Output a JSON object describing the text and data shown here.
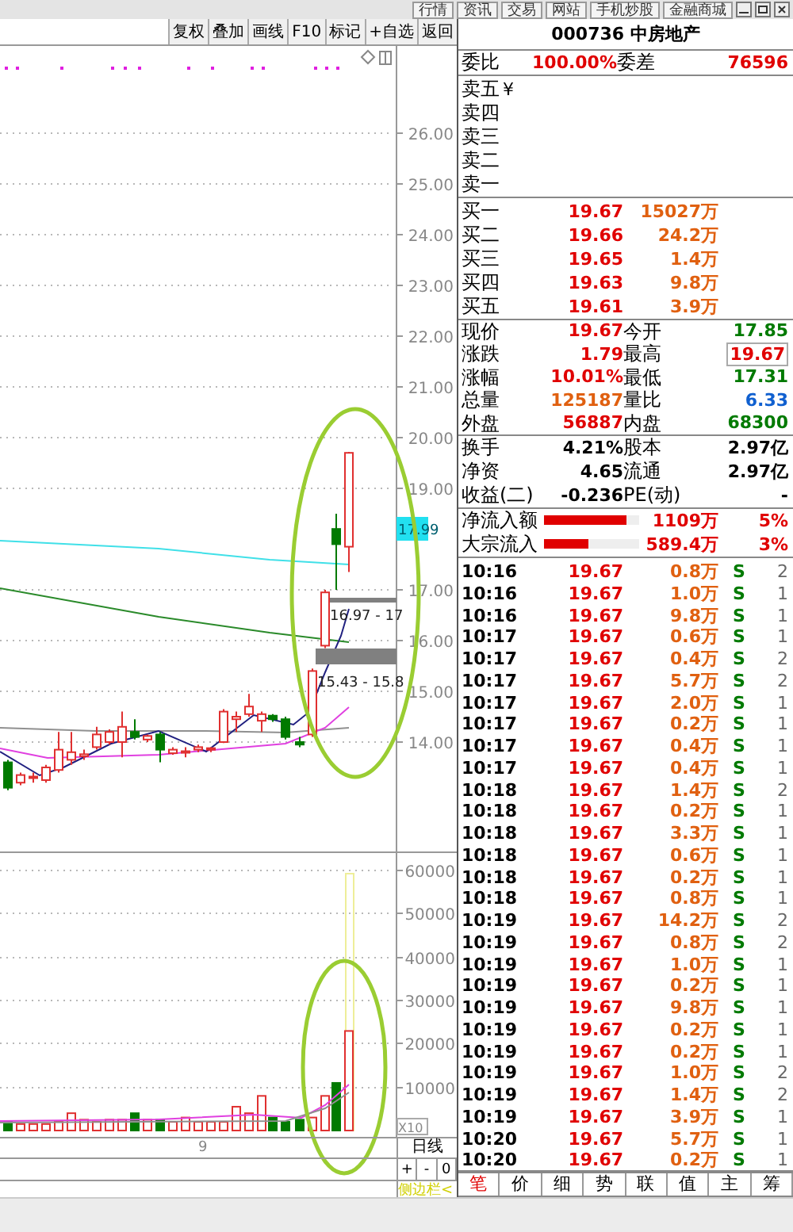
{
  "top_menu": [
    "行情",
    "资讯",
    "交易",
    "网站",
    "手机炒股",
    "金融商城"
  ],
  "toolbar": [
    "复权",
    "叠加",
    "画线",
    "F10",
    "标记",
    "+自选",
    "返回"
  ],
  "price_chart": {
    "axis_labels": [
      {
        "label": "26.00"
      },
      {
        "label": "25.00"
      },
      {
        "label": "24.00"
      },
      {
        "label": "23.00"
      },
      {
        "label": "22.00"
      },
      {
        "label": "21.00"
      },
      {
        "label": "20.00"
      },
      {
        "label": "19.00"
      },
      {
        "label": "17.00"
      },
      {
        "label": "16.00"
      },
      {
        "label": "15.00"
      },
      {
        "label": "14.00"
      }
    ],
    "current_price_tag": "17.99",
    "range_labels": [
      "16.97 - 17",
      "15.43 - 15.8"
    ]
  },
  "volume_chart": {
    "axis_labels": [
      "60000",
      "50000",
      "40000",
      "30000",
      "20000",
      "10000"
    ],
    "scale_label": "X10",
    "date_label": "9"
  },
  "period": {
    "label": "日线",
    "buttons": [
      "+",
      "-",
      "0"
    ],
    "sidebar_toggle": "侧边栏<"
  },
  "quote": {
    "title": "000736 中房地产",
    "weibi": {
      "label": "委比",
      "value": "100.00%",
      "diff_label": "委差",
      "diff": "76596"
    },
    "currency_mark": "¥",
    "sell": [
      {
        "label": "卖五"
      },
      {
        "label": "卖四"
      },
      {
        "label": "卖三"
      },
      {
        "label": "卖二"
      },
      {
        "label": "卖一"
      }
    ],
    "buy": [
      {
        "label": "买一",
        "price": "19.67",
        "volume": "15027万"
      },
      {
        "label": "买二",
        "price": "19.66",
        "volume": "24.2万"
      },
      {
        "label": "买三",
        "price": "19.65",
        "volume": "1.4万"
      },
      {
        "label": "买四",
        "price": "19.63",
        "volume": "9.8万"
      },
      {
        "label": "买五",
        "price": "19.61",
        "volume": "3.9万"
      }
    ],
    "stats": [
      [
        {
          "label": "现价",
          "value": "19.67",
          "color": "#e00000",
          "boxed": false
        },
        {
          "label": "今开",
          "value": "17.85",
          "color": "#007a00",
          "boxed": false
        }
      ],
      [
        {
          "label": "涨跌",
          "value": "1.79",
          "color": "#e00000",
          "boxed": false
        },
        {
          "label": "最高",
          "value": "19.67",
          "color": "#e00000",
          "boxed": true
        }
      ],
      [
        {
          "label": "涨幅",
          "value": "10.01%",
          "color": "#e00000",
          "boxed": false
        },
        {
          "label": "最低",
          "value": "17.31",
          "color": "#007a00",
          "boxed": false
        }
      ],
      [
        {
          "label": "总量",
          "value": "125187",
          "color": "#e06010",
          "boxed": false
        },
        {
          "label": "量比",
          "value": "6.33",
          "color": "#1060d0",
          "boxed": false
        }
      ],
      [
        {
          "label": "外盘",
          "value": "56887",
          "color": "#e00000",
          "boxed": false
        },
        {
          "label": "内盘",
          "value": "68300",
          "color": "#007a00",
          "boxed": false
        }
      ]
    ],
    "fundamentals": [
      [
        {
          "label": "换手",
          "value": "4.21%"
        },
        {
          "label": "股本",
          "value": "2.97亿"
        }
      ],
      [
        {
          "label": "净资",
          "value": "4.65"
        },
        {
          "label": "流通",
          "value": "2.97亿"
        }
      ],
      [
        {
          "label": "收益(二)",
          "value": "-0.236"
        },
        {
          "label": "PE(动)",
          "value": "-"
        }
      ]
    ],
    "flows": [
      {
        "label": "净流入额",
        "level": 0.87,
        "value": "1109万",
        "pct": "5%"
      },
      {
        "label": "大宗流入",
        "level": 0.47,
        "value": "589.4万",
        "pct": "3%"
      }
    ]
  },
  "trades": [
    {
      "time": "10:16",
      "price": "19.67",
      "volume": "0.8万",
      "side": "S",
      "count": "2"
    },
    {
      "time": "10:16",
      "price": "19.67",
      "volume": "1.0万",
      "side": "S",
      "count": "1"
    },
    {
      "time": "10:16",
      "price": "19.67",
      "volume": "9.8万",
      "side": "S",
      "count": "1"
    },
    {
      "time": "10:17",
      "price": "19.67",
      "volume": "0.6万",
      "side": "S",
      "count": "1"
    },
    {
      "time": "10:17",
      "price": "19.67",
      "volume": "0.4万",
      "side": "S",
      "count": "2"
    },
    {
      "time": "10:17",
      "price": "19.67",
      "volume": "5.7万",
      "side": "S",
      "count": "2"
    },
    {
      "time": "10:17",
      "price": "19.67",
      "volume": "2.0万",
      "side": "S",
      "count": "1"
    },
    {
      "time": "10:17",
      "price": "19.67",
      "volume": "0.2万",
      "side": "S",
      "count": "1"
    },
    {
      "time": "10:17",
      "price": "19.67",
      "volume": "0.4万",
      "side": "S",
      "count": "1"
    },
    {
      "time": "10:17",
      "price": "19.67",
      "volume": "0.4万",
      "side": "S",
      "count": "1"
    },
    {
      "time": "10:18",
      "price": "19.67",
      "volume": "1.4万",
      "side": "S",
      "count": "2"
    },
    {
      "time": "10:18",
      "price": "19.67",
      "volume": "0.2万",
      "side": "S",
      "count": "1"
    },
    {
      "time": "10:18",
      "price": "19.67",
      "volume": "3.3万",
      "side": "S",
      "count": "1"
    },
    {
      "time": "10:18",
      "price": "19.67",
      "volume": "0.6万",
      "side": "S",
      "count": "1"
    },
    {
      "time": "10:18",
      "price": "19.67",
      "volume": "0.2万",
      "side": "S",
      "count": "1"
    },
    {
      "time": "10:18",
      "price": "19.67",
      "volume": "0.8万",
      "side": "S",
      "count": "1"
    },
    {
      "time": "10:19",
      "price": "19.67",
      "volume": "14.2万",
      "side": "S",
      "count": "2"
    },
    {
      "time": "10:19",
      "price": "19.67",
      "volume": "0.8万",
      "side": "S",
      "count": "2"
    },
    {
      "time": "10:19",
      "price": "19.67",
      "volume": "1.0万",
      "side": "S",
      "count": "1"
    },
    {
      "time": "10:19",
      "price": "19.67",
      "volume": "0.2万",
      "side": "S",
      "count": "1"
    },
    {
      "time": "10:19",
      "price": "19.67",
      "volume": "9.8万",
      "side": "S",
      "count": "1"
    },
    {
      "time": "10:19",
      "price": "19.67",
      "volume": "0.2万",
      "side": "S",
      "count": "1"
    },
    {
      "time": "10:19",
      "price": "19.67",
      "volume": "0.2万",
      "side": "S",
      "count": "1"
    },
    {
      "time": "10:19",
      "price": "19.67",
      "volume": "1.0万",
      "side": "S",
      "count": "2"
    },
    {
      "time": "10:19",
      "price": "19.67",
      "volume": "1.4万",
      "side": "S",
      "count": "2"
    },
    {
      "time": "10:19",
      "price": "19.67",
      "volume": "3.9万",
      "side": "S",
      "count": "1"
    },
    {
      "time": "10:20",
      "price": "19.67",
      "volume": "5.7万",
      "side": "S",
      "count": "1"
    },
    {
      "time": "10:20",
      "price": "19.67",
      "volume": "0.2万",
      "side": "S",
      "count": "1"
    }
  ],
  "bottom_tabs": [
    {
      "label": "笔",
      "selected": true
    },
    {
      "label": "价",
      "selected": false
    },
    {
      "label": "细",
      "selected": false
    },
    {
      "label": "势",
      "selected": false
    },
    {
      "label": "联",
      "selected": false
    },
    {
      "label": "值",
      "selected": false
    },
    {
      "label": "主",
      "selected": false
    },
    {
      "label": "筹",
      "selected": false
    }
  ]
}
